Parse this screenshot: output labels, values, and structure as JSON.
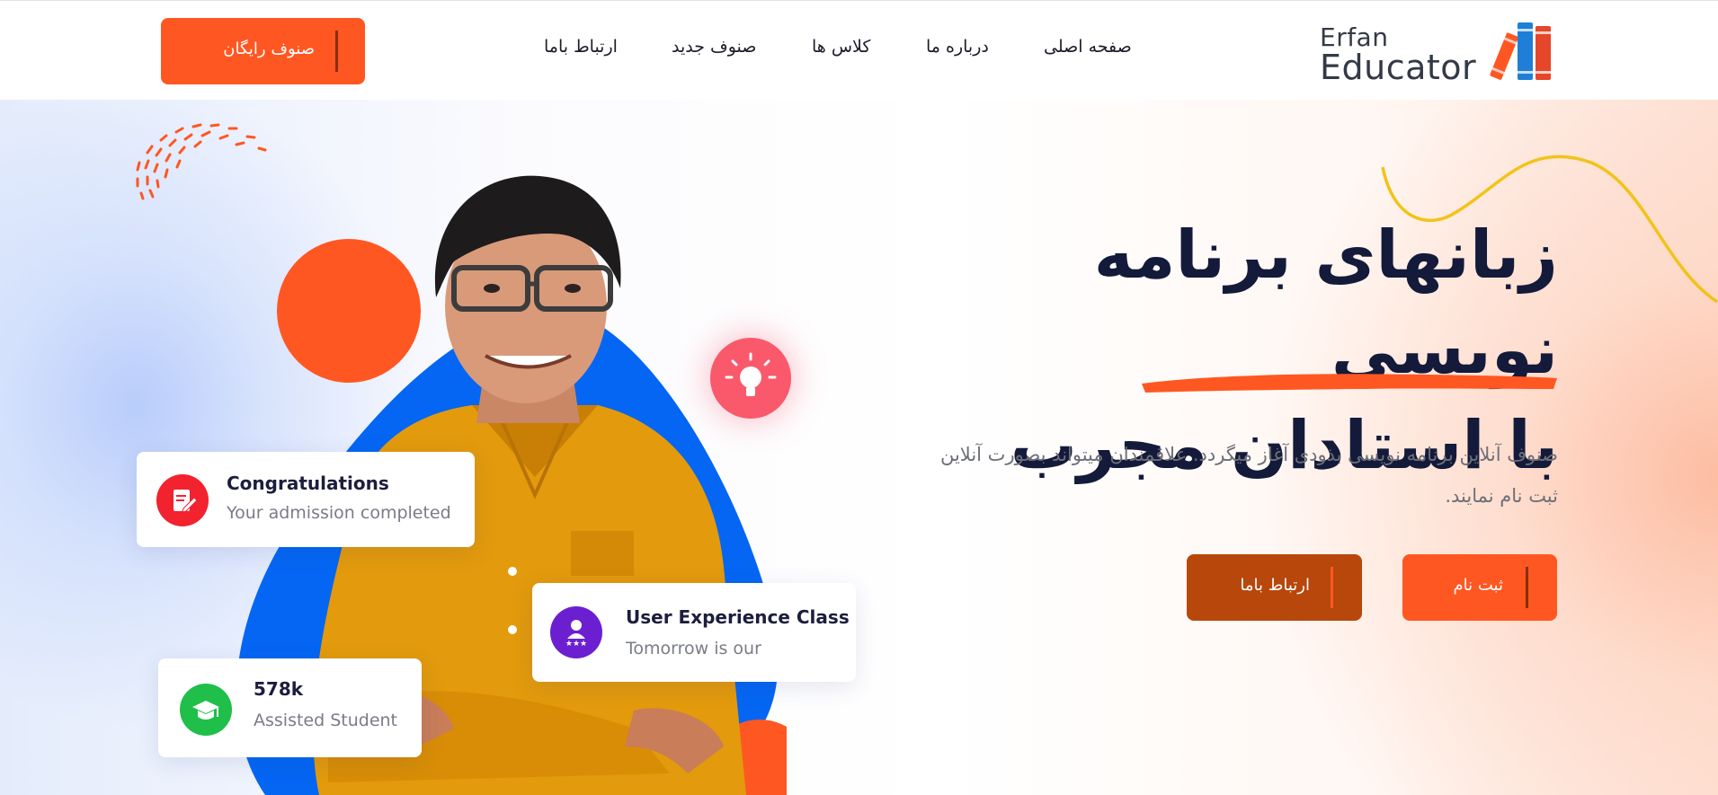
{
  "header": {
    "logo": {
      "line1": "Erfan",
      "line2": "Educator"
    },
    "nav": [
      {
        "label": "صفحه اصلی"
      },
      {
        "label": "درباره ما"
      },
      {
        "label": "کلاس ها"
      },
      {
        "label": "صنوف جدید"
      },
      {
        "label": "ارتباط باما"
      }
    ],
    "cta_label": "صنوف رایگان"
  },
  "hero": {
    "headline_line1": "زبانهای برنامه نویسی",
    "headline_line2": "با استادان مجرب",
    "description_line1": "صنوف آنلاین برنامه نویسی بذودی آغاز میگردد. علاقمندان میتواند بصورت آنلاین",
    "description_line2": "ثبت نام نمایند.",
    "register_label": "ثبت نام",
    "contact_label": "ارتباط باما"
  },
  "cards": {
    "congrats": {
      "title": "Congratulations",
      "subtitle": "Your admission completed",
      "icon": "edit-document-icon"
    },
    "ux_class": {
      "title": "User Experience Class",
      "subtitle": "Tomorrow is our",
      "icon": "rating-user-icon"
    },
    "students": {
      "title": "578k",
      "subtitle": "Assisted Student",
      "icon": "graduation-cap-icon"
    }
  },
  "colors": {
    "brand_orange": "#ff5722",
    "dark_orange": "#b8470b",
    "blue": "#0466f3",
    "headline": "#131a3a",
    "bulb_pink": "#f9596b"
  }
}
